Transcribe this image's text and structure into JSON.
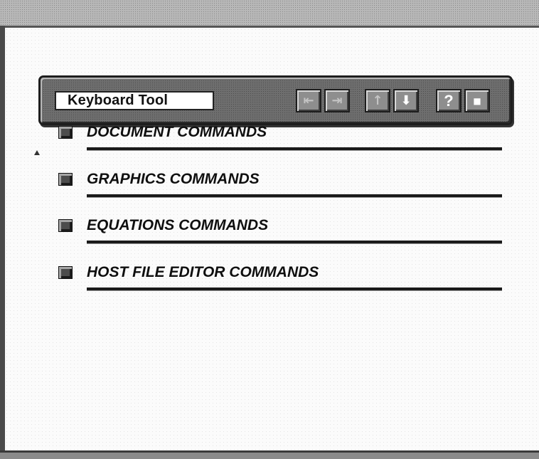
{
  "window": {
    "title": "Keyboard Tool"
  },
  "toolbar": {
    "buttons": [
      {
        "name": "back-button",
        "icon": "arrow-left-icon",
        "glyph": "⇤",
        "enabled": false
      },
      {
        "name": "forward-button",
        "icon": "arrow-right-icon",
        "glyph": "⇥",
        "enabled": false
      },
      {
        "name": "up-button",
        "icon": "arrow-up-icon",
        "glyph": "↑",
        "enabled": false
      },
      {
        "name": "down-button",
        "icon": "arrow-down-icon",
        "glyph": "⬇",
        "enabled": true
      },
      {
        "name": "help-button",
        "icon": "question-mark-icon",
        "glyph": "?",
        "enabled": true
      },
      {
        "name": "close-button",
        "icon": "close-square-icon",
        "glyph": "■",
        "enabled": true
      }
    ]
  },
  "commands": {
    "selected_index": 0,
    "items": [
      {
        "label": "DOCUMENT COMMANDS"
      },
      {
        "label": "GRAPHICS COMMANDS"
      },
      {
        "label": "EQUATIONS COMMANDS"
      },
      {
        "label": "HOST FILE EDITOR COMMANDS"
      }
    ]
  },
  "colors": {
    "panel": "#6e6e6e",
    "button_face": "#8e8e8e",
    "bullet": "#4c4c4c",
    "text": "#0f0f0f"
  }
}
